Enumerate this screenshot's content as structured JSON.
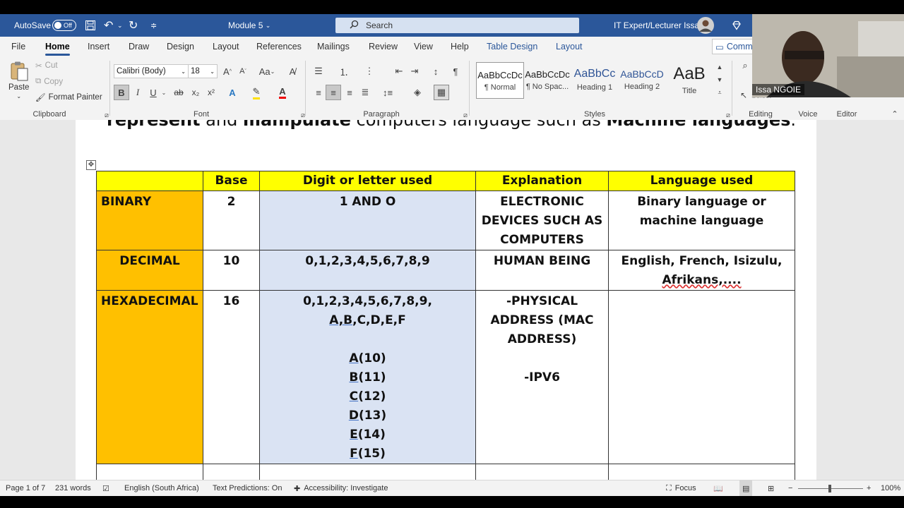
{
  "title_bar": {
    "autosave_label": "AutoSave",
    "autosave_state": "Off",
    "doc_title": "Module 5",
    "search_placeholder": "Search",
    "user_name": "IT Expert/Lecturer Issa"
  },
  "menu_tabs": [
    "File",
    "Home",
    "Insert",
    "Draw",
    "Design",
    "Layout",
    "References",
    "Mailings",
    "Review",
    "View",
    "Help",
    "Table Design",
    "Layout"
  ],
  "comments_label": "Comm",
  "ribbon": {
    "clipboard": {
      "paste": "Paste",
      "cut": "Cut",
      "copy": "Copy",
      "format_painter": "Format Painter",
      "group_label": "Clipboard"
    },
    "font": {
      "font_name": "Calibri (Body)",
      "font_size": "18",
      "change_case": "Aa",
      "group_label": "Font",
      "bold": "B",
      "italic": "I",
      "underline": "U"
    },
    "paragraph": {
      "group_label": "Paragraph"
    },
    "styles": {
      "items": [
        {
          "preview": "AaBbCcDc",
          "name": "¶ Normal"
        },
        {
          "preview": "AaBbCcDc",
          "name": "¶ No Spac..."
        },
        {
          "preview": "AaBbCc",
          "name": "Heading 1"
        },
        {
          "preview": "AaBbCcD",
          "name": "Heading 2"
        },
        {
          "preview": "AaB",
          "name": "Title"
        }
      ],
      "group_label": "Styles"
    },
    "editing": {
      "group_label": "Editing",
      "select_label": "Select"
    },
    "voice": {
      "group_label": "Voice"
    },
    "editor": {
      "group_label": "Editor"
    }
  },
  "webcam": {
    "name": "Issa NGOIE"
  },
  "document": {
    "sentence_parts": [
      "represent",
      " and ",
      "manipulate",
      " computers language such as ",
      "Machine languages",
      "."
    ],
    "table": {
      "headers": [
        "",
        "Base",
        "Digit or letter used",
        "Explanation",
        "Language used"
      ],
      "rows": [
        {
          "system": "BINARY",
          "base": "2",
          "digits": "1 AND O",
          "explanation": "ELECTRONIC DEVICES SUCH AS COMPUTERS",
          "language": "Binary language or machine language"
        },
        {
          "system": "DECIMAL",
          "base": "10",
          "digits": "0,1,2,3,4,5,6,7,8,9",
          "explanation": "HUMAN BEING",
          "language_main": "English, French, Isizulu,",
          "language_tail": "Afrikans,...."
        },
        {
          "system": "HEXADECIMAL",
          "base": "16",
          "digits_prefix": "0,1,2,3,4,5,6,7,8,9, ",
          "digits_letters": "A,B",
          "digits_suffix": ",C,D,E,F",
          "hex_values": [
            {
              "letter": "A",
              "value": "(10)"
            },
            {
              "letter": "B",
              "value": "(11)"
            },
            {
              "letter": "C",
              "value": "(12)"
            },
            {
              "letter": "D",
              "value": "(13)"
            },
            {
              "letter": "E",
              "value": "(14)"
            },
            {
              "letter": "F",
              "value": "(15)"
            }
          ],
          "explanation_1": "-PHYSICAL ADDRESS (MAC ADDRESS)",
          "explanation_2": "-IPV6",
          "language": ""
        }
      ]
    }
  },
  "status_bar": {
    "page": "Page 1 of 7",
    "words": "231 words",
    "language": "English (South Africa)",
    "predictions": "Text Predictions: On",
    "accessibility": "Accessibility: Investigate",
    "focus": "Focus",
    "zoom": "100%"
  },
  "colors": {
    "word_blue": "#2b579a",
    "header_yellow": "#ffff00",
    "system_orange": "#ffc000",
    "digits_blue": "#dae3f3"
  }
}
